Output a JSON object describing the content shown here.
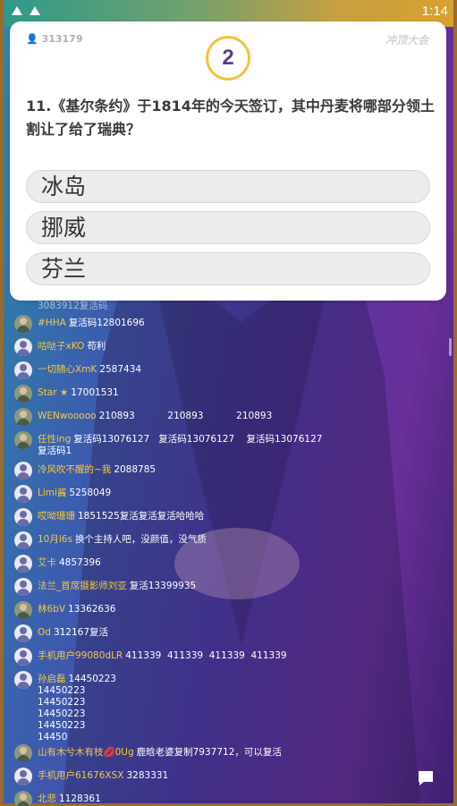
{
  "status": {
    "time": "1:14"
  },
  "quiz": {
    "viewer_count": "313179",
    "brand": "冲顶大会",
    "countdown": "2",
    "question": "11.《基尔条约》于1814年的今天签订，其中丹麦将哪部分领土割让了给了瑞典？",
    "options": [
      "冰岛",
      "挪威",
      "芬兰"
    ]
  },
  "chat": {
    "partial_top": "3083912复活码",
    "items": [
      {
        "user": "#HHA",
        "msg": "复活码12801696"
      },
      {
        "user": "咕哒子xKO",
        "msg": "苟利"
      },
      {
        "user": "一切随心XmK",
        "msg": "2587434"
      },
      {
        "user": "Star ★",
        "msg": "17001531"
      },
      {
        "user": "WENwooooo",
        "msg": "210893           210893           210893"
      },
      {
        "user": "任性ing",
        "msg": "复活码13076127   复活码13076127    复活码13076127\n复活码1"
      },
      {
        "user": "冷风吹不醒的~我",
        "msg": "2088785"
      },
      {
        "user": "Limi酱",
        "msg": "5258049"
      },
      {
        "user": "哎呦珊珊",
        "msg": "1851525复活复活复活哈哈哈"
      },
      {
        "user": "10月l6s",
        "msg": "换个主持人吧，没颜值，没气质"
      },
      {
        "user": "艾卡",
        "msg": "4857396"
      },
      {
        "user": "法兰_首席摄影师刘亚",
        "msg": "复活13399935"
      },
      {
        "user": "林6bV",
        "msg": "13362636"
      },
      {
        "user": "Od",
        "msg": "312167复活"
      },
      {
        "user": "手机用户99080dLR",
        "msg": "411339  411339  411339  411339"
      },
      {
        "user": "孙启磊",
        "msg": "14450223\n14450223\n14450223\n14450223\n14450223\n14450"
      },
      {
        "user": "山有木兮木有枝💋0Ug",
        "msg": "鹿晗老婆复制7937712，可以复活"
      },
      {
        "user": "手机用户61676XSX",
        "msg": "3283331"
      },
      {
        "user": "北悲",
        "msg": "1128361"
      }
    ]
  }
}
